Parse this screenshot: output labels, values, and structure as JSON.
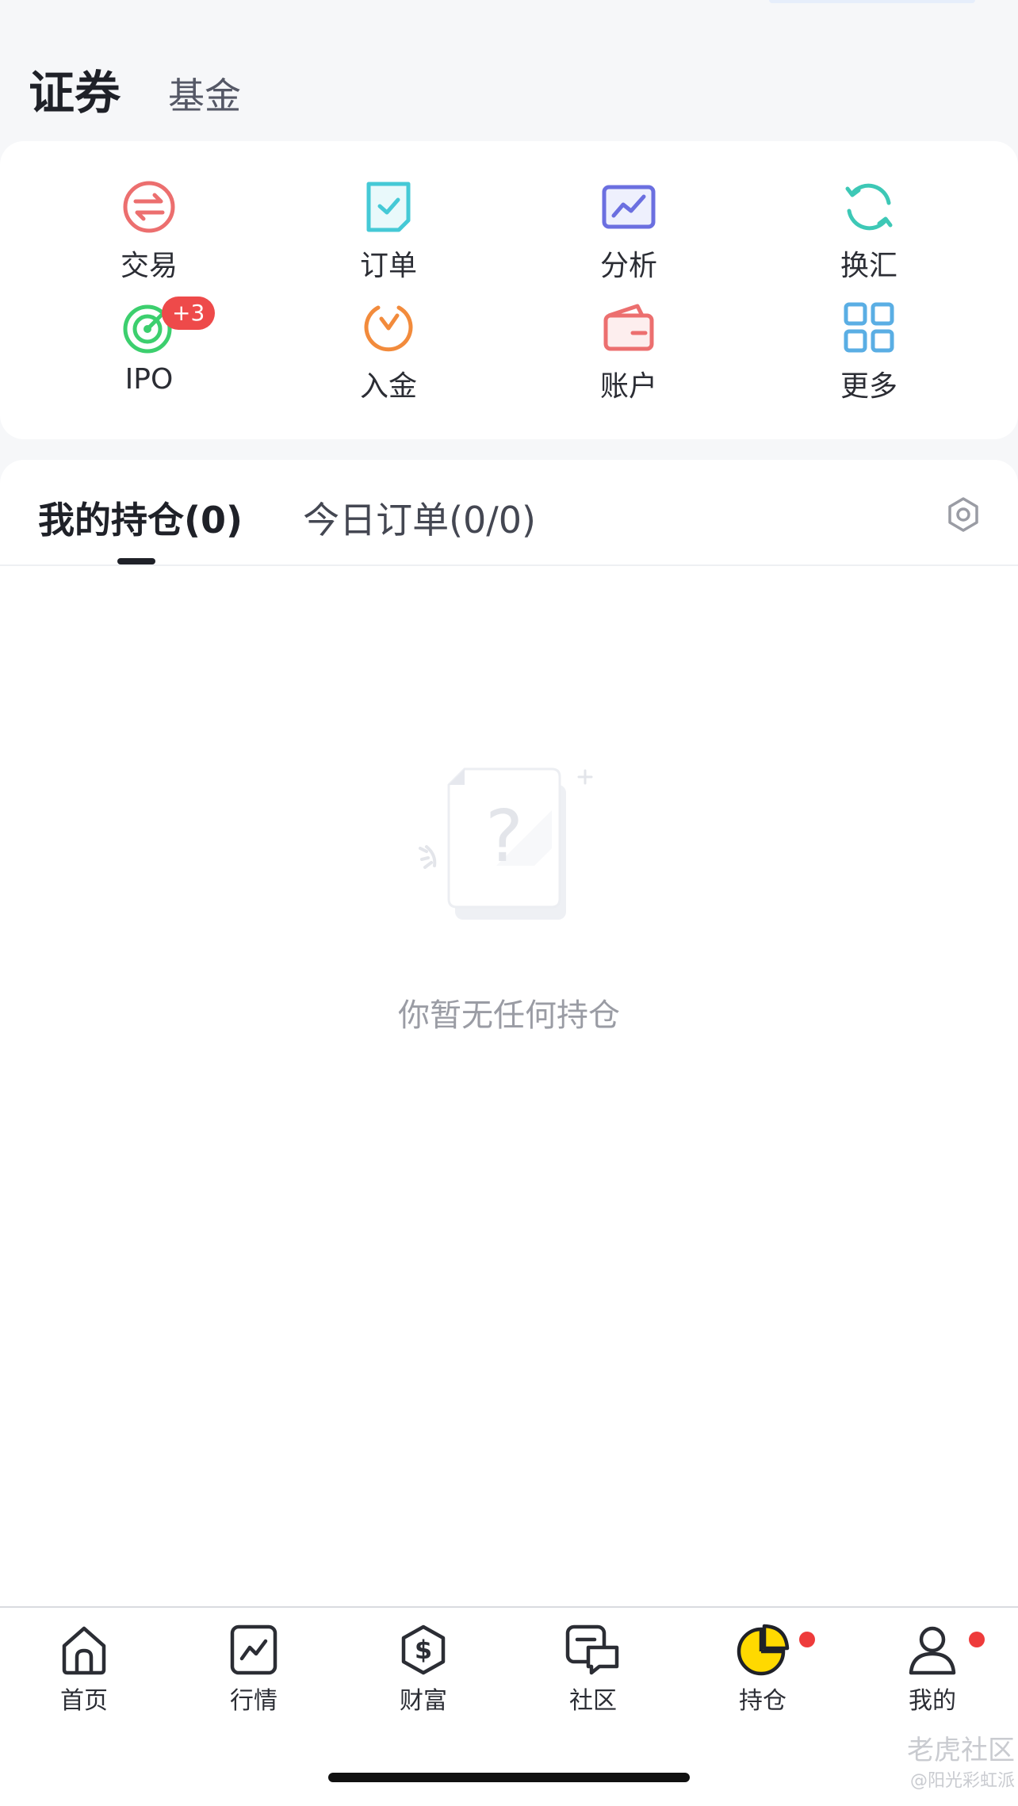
{
  "header": {
    "tabs": [
      "证券",
      "基金"
    ]
  },
  "quick_actions": [
    {
      "label": "交易",
      "icon": "exchange-icon",
      "color": "#ec6f6f"
    },
    {
      "label": "订单",
      "icon": "order-icon",
      "color": "#45c9d6"
    },
    {
      "label": "分析",
      "icon": "analysis-icon",
      "color": "#6b6fe0"
    },
    {
      "label": "换汇",
      "icon": "currency-exchange-icon",
      "color": "#3dc8b6"
    },
    {
      "label": "IPO",
      "icon": "target-icon",
      "color": "#3ccf6e",
      "badge": "+3"
    },
    {
      "label": "入金",
      "icon": "deposit-icon",
      "color": "#f28b3c"
    },
    {
      "label": "账户",
      "icon": "wallet-icon",
      "color": "#ec6f6f"
    },
    {
      "label": "更多",
      "icon": "grid-icon",
      "color": "#5aaee4"
    }
  ],
  "holdings": {
    "tabs": [
      "我的持仓(0)",
      "今日订单(0/0)"
    ],
    "empty_message": "你暂无任何持仓"
  },
  "tabbar": [
    {
      "label": "首页",
      "icon": "home-icon"
    },
    {
      "label": "行情",
      "icon": "market-icon"
    },
    {
      "label": "财富",
      "icon": "wealth-icon"
    },
    {
      "label": "社区",
      "icon": "community-icon"
    },
    {
      "label": "持仓",
      "icon": "holdings-pie-icon",
      "active": true,
      "dot": true
    },
    {
      "label": "我的",
      "icon": "profile-icon",
      "dot": true
    }
  ],
  "watermark": {
    "brand": "老虎社区",
    "handle": "@阳光彩虹派"
  },
  "colors": {
    "accent": "#ffd900",
    "badge": "#ee4a4a",
    "text": "#23252c"
  }
}
